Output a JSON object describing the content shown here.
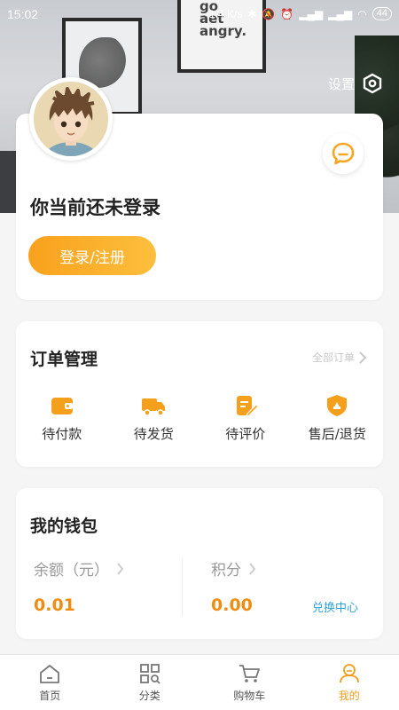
{
  "status_bar": {
    "time": "15:02",
    "speed": "1.4 K/s",
    "battery": "44"
  },
  "header": {
    "settings_label": "设置"
  },
  "poster_lines": [
    "go",
    "aet",
    "angry."
  ],
  "profile": {
    "login_prompt": "你当前还未登录",
    "login_button": "登录/注册",
    "avatar_icon": "avatar-cartoon-icon",
    "message_icon": "chat-bubble-icon"
  },
  "orders": {
    "title": "订单管理",
    "all_orders": "全部订单",
    "items": [
      {
        "label": "待付款",
        "icon": "wallet-icon"
      },
      {
        "label": "待发货",
        "icon": "truck-icon"
      },
      {
        "label": "待评价",
        "icon": "review-icon"
      },
      {
        "label": "售后/退货",
        "icon": "shield-icon"
      }
    ]
  },
  "wallet": {
    "title": "我的钱包",
    "balance_label": "余额（元）",
    "balance_value": "0.01",
    "points_label": "积分",
    "points_value": "0.00",
    "exchange_label": "兑换中心"
  },
  "tabbar": {
    "items": [
      {
        "label": "首页",
        "icon": "home-icon",
        "active": false
      },
      {
        "label": "分类",
        "icon": "category-icon",
        "active": false
      },
      {
        "label": "购物车",
        "icon": "cart-icon",
        "active": false
      },
      {
        "label": "我的",
        "icon": "profile-icon",
        "active": true
      }
    ]
  },
  "colors": {
    "accent": "#f39c1a",
    "link": "#2fa3d9",
    "value": "#f08c12"
  }
}
